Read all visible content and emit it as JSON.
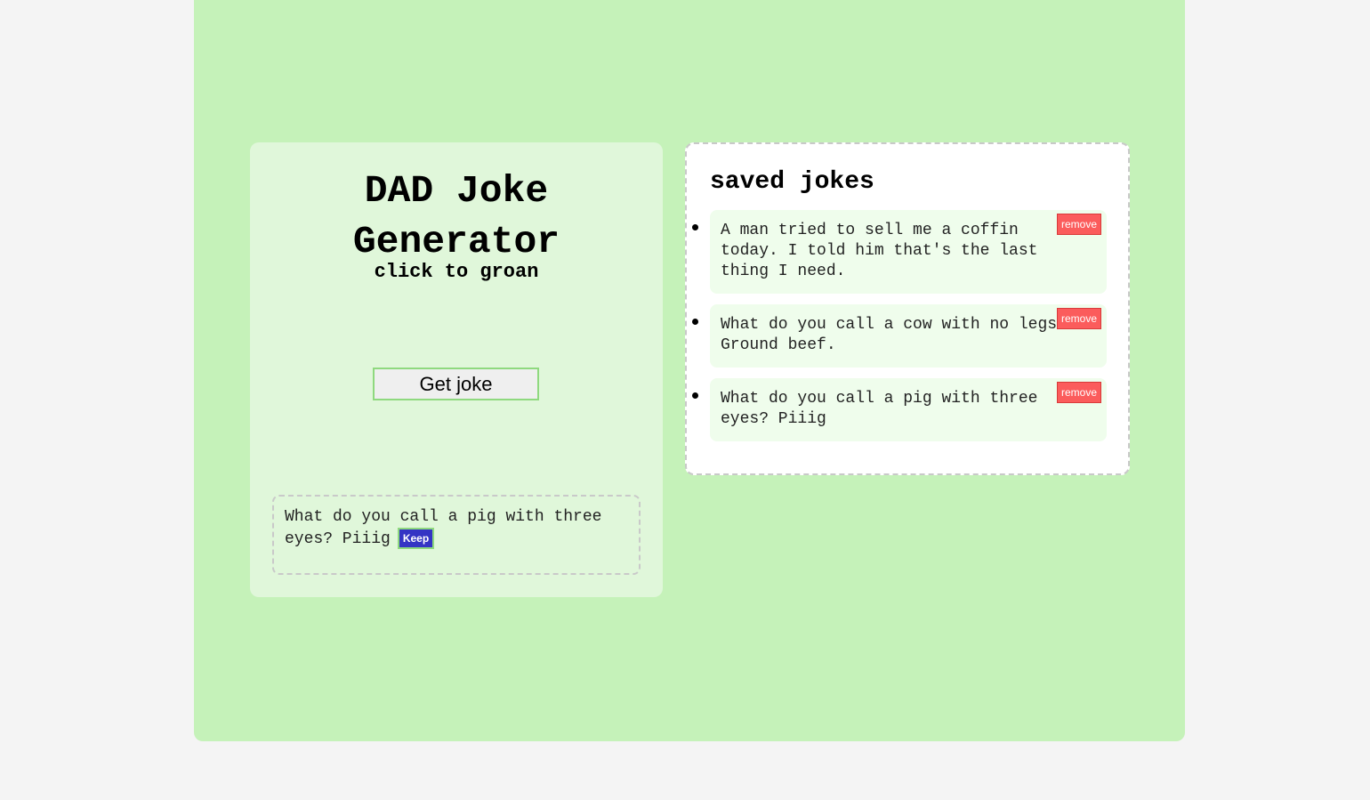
{
  "generator": {
    "title": "DAD Joke Generator",
    "subtitle": "click to groan",
    "get_joke_label": "Get joke",
    "current_joke": "What do you call a pig with three eyes? Piiig",
    "keep_label": "Keep"
  },
  "saved": {
    "title": "saved jokes",
    "items": [
      {
        "text": "A man tried to sell me a coffin today. I told him that's the last thing I need.",
        "remove_label": "remove"
      },
      {
        "text": "What do you call a cow with no legs? Ground beef.",
        "remove_label": "remove"
      },
      {
        "text": "What do you call a pig with three eyes? Piiig",
        "remove_label": "remove"
      }
    ]
  },
  "colors": {
    "page_bg": "#f4f4f4",
    "container_bg": "#c5f2b9",
    "panel_bg": "#e0f7da",
    "item_bg": "#effdec",
    "keep_button": "#3434c4",
    "remove_button": "#fb5c5c"
  }
}
